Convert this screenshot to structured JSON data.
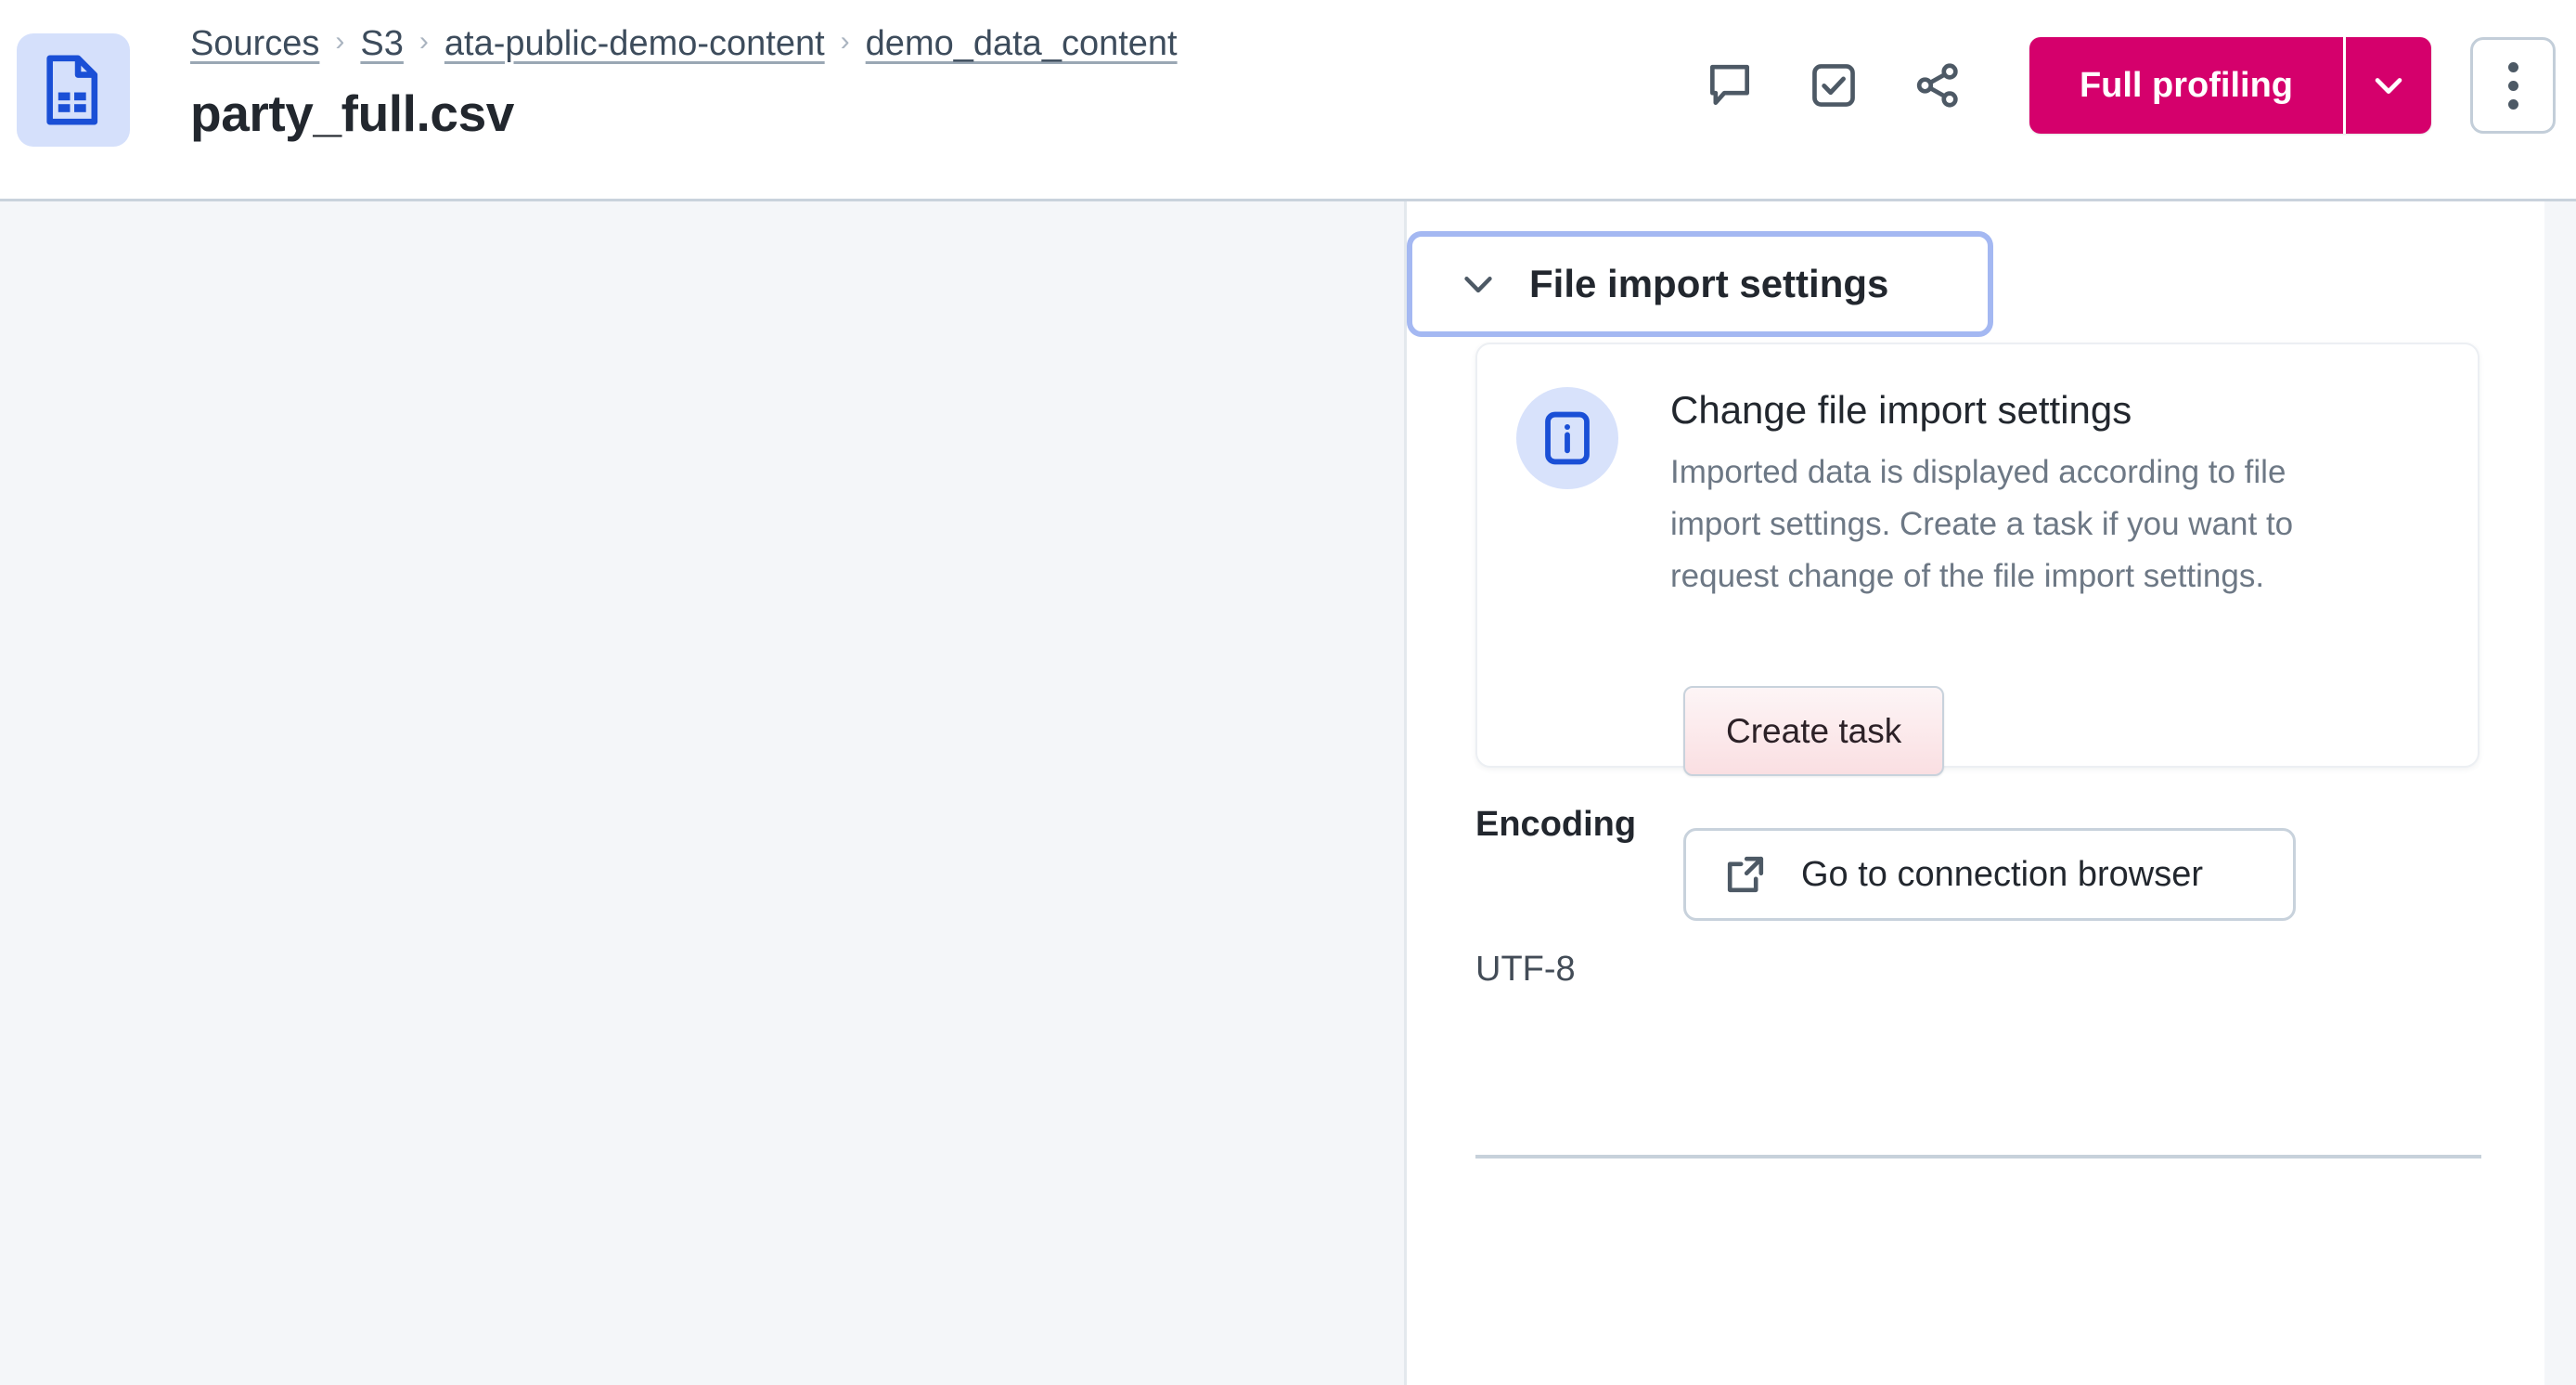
{
  "header": {
    "file_icon": "csv-file-icon",
    "breadcrumb": [
      {
        "label": "Sources"
      },
      {
        "label": "S3"
      },
      {
        "label": "ata-public-demo-content"
      },
      {
        "label": "demo_data_content"
      }
    ],
    "breadcrumb_separator": "›",
    "page_title": "party_full.csv",
    "actions": {
      "comment_icon": "comment-icon",
      "task_icon": "checkbox-check-icon",
      "share_icon": "share-icon",
      "primary_label": "Full profiling",
      "primary_caret_icon": "chevron-down-icon",
      "overflow_icon": "kebab-menu-icon",
      "accent_color": "#d5006c"
    }
  },
  "panel": {
    "section": {
      "toggle_icon": "chevron-down-icon",
      "title": "File import settings",
      "focus_ring_color": "#a4b8f2"
    },
    "info_card": {
      "icon": "info-icon",
      "icon_color": "#1a4fd6",
      "title": "Change file import settings",
      "description": "Imported data is displayed according to file import settings. Create a task if you want to request change of the file import settings.",
      "create_task_label": "Create task",
      "connection_browser_icon": "external-link-icon",
      "connection_browser_label": "Go to connection browser"
    },
    "fields": [
      {
        "label": "Encoding",
        "value": "UTF-8"
      }
    ]
  }
}
